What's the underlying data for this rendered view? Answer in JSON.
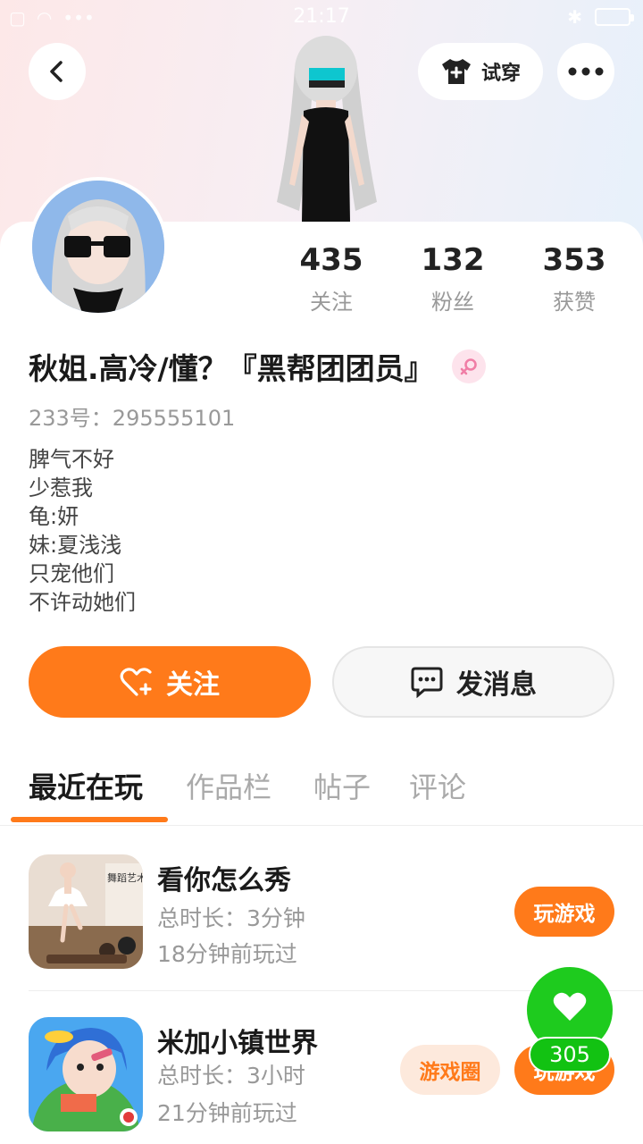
{
  "status_bar": {
    "time": "21:17"
  },
  "header": {
    "try_on_label": "试穿"
  },
  "profile": {
    "name": "秋姐.高冷/懂？『黑帮团团员』",
    "uid": "233号：295555101",
    "bio": [
      "脾气不好",
      "少惹我",
      "龟:妍",
      "妹:夏浅浅",
      "只宠他们",
      "不许动她们"
    ],
    "stats": [
      {
        "value": "435",
        "label": "关注"
      },
      {
        "value": "132",
        "label": "粉丝"
      },
      {
        "value": "353",
        "label": "获赞"
      }
    ]
  },
  "actions": {
    "follow_label": "关注",
    "message_label": "发消息"
  },
  "tabs": [
    {
      "label": "最近在玩",
      "active": true
    },
    {
      "label": "作品栏",
      "active": false
    },
    {
      "label": "帖子",
      "active": false
    },
    {
      "label": "评论",
      "active": false
    }
  ],
  "games": [
    {
      "title": "看你怎么秀",
      "duration": "总时长：3分钟",
      "last_played": "18分钟前玩过",
      "play_label": "玩游戏",
      "icon_text": "舞蹈艺术"
    },
    {
      "title": "米加小镇世界",
      "duration": "总时长：3小时",
      "last_played": "21分钟前玩过",
      "play_label": "玩游戏",
      "circle_label": "游戏圈"
    }
  ],
  "like_fab": {
    "count": "305"
  },
  "colors": {
    "accent": "#ff7a1a",
    "like_green": "#1ecb1e"
  }
}
